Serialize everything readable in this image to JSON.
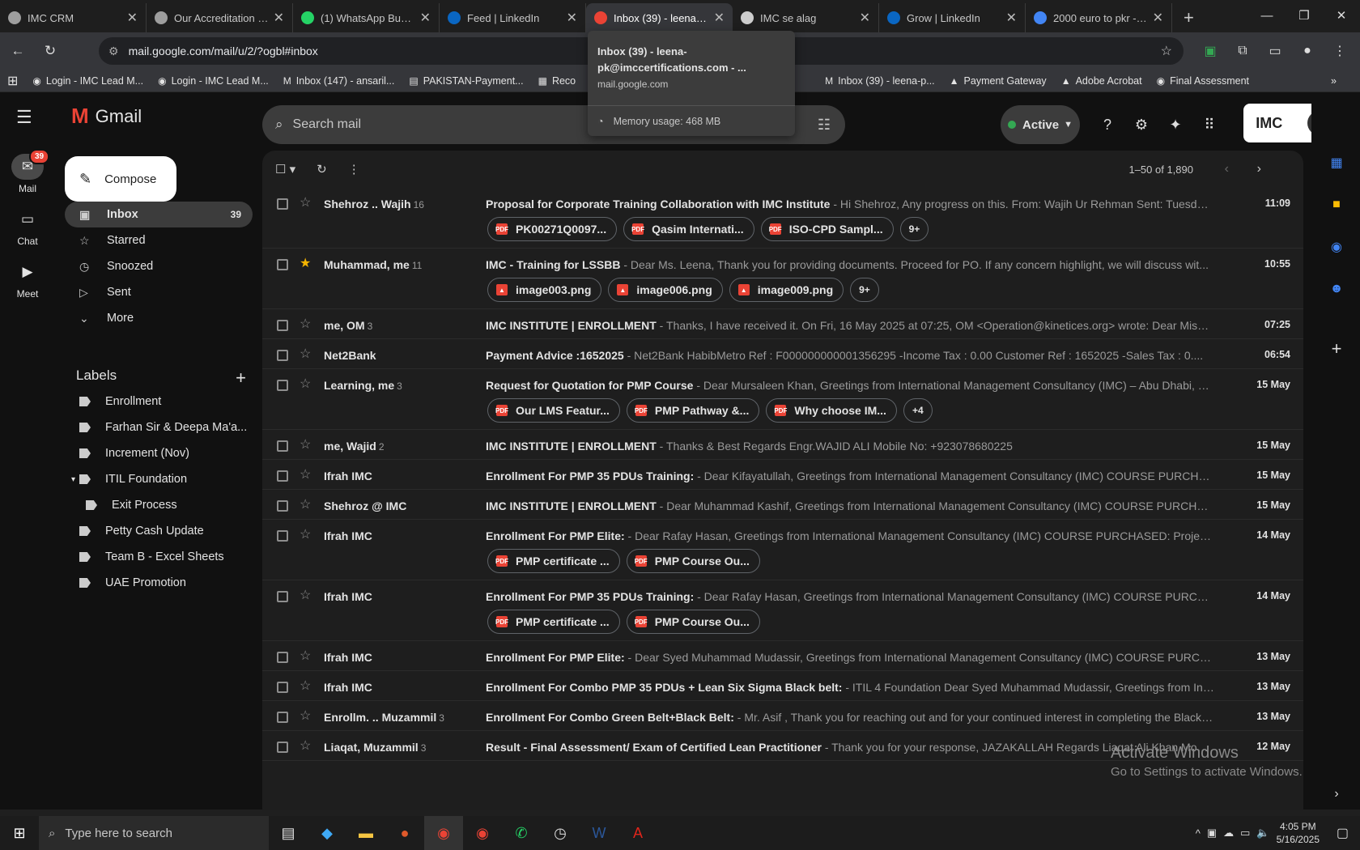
{
  "browser": {
    "tabs": [
      {
        "title": "IMC CRM",
        "color": "#9e9e9e"
      },
      {
        "title": "Our Accreditation | IMC",
        "color": "#9e9e9e"
      },
      {
        "title": "(1) WhatsApp Business",
        "color": "#25d366"
      },
      {
        "title": "Feed | LinkedIn",
        "color": "#0a66c2"
      },
      {
        "title": "Inbox (39) - leena-pk@",
        "color": "#ea4335"
      },
      {
        "title": "IMC se alag",
        "color": "#cccccc"
      },
      {
        "title": "Grow | LinkedIn",
        "color": "#0a66c2"
      },
      {
        "title": "2000 euro to pkr - Google",
        "color": "#4285f4"
      }
    ],
    "active_tab_index": 4,
    "url": "mail.google.com/mail/u/2/?ogbl#inbox",
    "bookmarks": [
      "Login - IMC Lead M...",
      "Login - IMC Lead M...",
      "Inbox (147) - ansaril...",
      "PAKISTAN-Payment...",
      "Reco",
      "Inbox (39) - leena-p...",
      "Payment Gateway",
      "Adobe Acrobat",
      "Final Assessment"
    ],
    "tooltip": {
      "title": "Inbox (39) - leena-pk@imccertifications.com - ...",
      "url": "mail.google.com",
      "memory": "Memory usage: 468 MB"
    }
  },
  "gmail": {
    "logo": "Gmail",
    "search_placeholder": "Search mail",
    "status": "Active",
    "rail": [
      {
        "label": "Mail",
        "badge": "39"
      },
      {
        "label": "Chat"
      },
      {
        "label": "Meet"
      }
    ],
    "compose": "Compose",
    "nav": [
      {
        "label": "Inbox",
        "count": "39"
      },
      {
        "label": "Starred"
      },
      {
        "label": "Snoozed"
      },
      {
        "label": "Sent"
      },
      {
        "label": "More"
      }
    ],
    "labels_title": "Labels",
    "labels": [
      "Enrollment",
      "Farhan Sir & Deepa Ma'a...",
      "Increment (Nov)",
      "ITIL Foundation",
      "Exit Process",
      "Petty Cash Update",
      "Team B - Excel Sheets",
      "UAE Promotion"
    ],
    "range": "1–50 of 1,890",
    "imc_brand": "IMC",
    "emails": [
      {
        "sender": "Shehroz .. Wajih",
        "count": "16",
        "subject": "Proposal for Corporate Training Collaboration with IMC Institute",
        "snippet": " - Hi Shehroz, Any progress on this. From: Wajih Ur Rehman Sent: Tuesday, M...",
        "date": "11:09",
        "starred": false,
        "attachments": [
          "PK00271Q0097...",
          "Qasim Internati...",
          "ISO-CPD Sampl..."
        ],
        "more": "9+"
      },
      {
        "sender": "Muhammad, me",
        "count": "11",
        "subject": "IMC - Training for LSSBB",
        "snippet": " - Dear Ms. Leena, Thank you for providing documents. Proceed for PO. If any concern highlight, we will discuss wit...",
        "date": "10:55",
        "starred": true,
        "attachments": [
          "image003.png",
          "image006.png",
          "image009.png"
        ],
        "more": "9+"
      },
      {
        "sender": "me, OM",
        "count": "3",
        "subject": "IMC INSTITUTE | ENROLLMENT",
        "snippet": " - Thanks, I have received it. On Fri, 16 May 2025 at 07:25, OM <Operation@kinetices.org> wrote: Dear Miss Le...",
        "date": "07:25",
        "starred": false,
        "attachments": [],
        "more": ""
      },
      {
        "sender": "Net2Bank",
        "count": "",
        "subject": "Payment Advice :1652025",
        "snippet": " - Net2Bank HabibMetro Ref : F000000000001356295 -Income Tax : 0.00 Customer Ref : 1652025 -Sales Tax : 0....",
        "date": "06:54",
        "starred": false,
        "attachments": [],
        "more": ""
      },
      {
        "sender": "Learning, me",
        "count": "3",
        "subject": "Request for Quotation for PMP Course",
        "snippet": " - Dear Mursaleen Khan, Greetings from International Management Consultancy (IMC) – Abu Dhabi, U...",
        "date": "15 May",
        "starred": false,
        "attachments": [
          "Our LMS Featur...",
          "PMP Pathway &...",
          "Why choose IM..."
        ],
        "more": "+4"
      },
      {
        "sender": "me, Wajid",
        "count": "2",
        "subject": "IMC INSTITUTE | ENROLLMENT",
        "snippet": " - Thanks & Best Regards Engr.WAJID ALI Mobile No: +923078680225",
        "date": "15 May",
        "starred": false,
        "attachments": [],
        "more": ""
      },
      {
        "sender": "Ifrah IMC",
        "count": "",
        "subject": "Enrollment For PMP 35 PDUs Training:",
        "snippet": " - Dear Kifayatullah, Greetings from International Management Consultancy (IMC) COURSE PURCHASE...",
        "date": "15 May",
        "starred": false,
        "attachments": [],
        "more": ""
      },
      {
        "sender": "Shehroz @ IMC",
        "count": "",
        "subject": "IMC INSTITUTE | ENROLLMENT",
        "snippet": " - Dear Muhammad Kashif, Greetings from International Management Consultancy (IMC) COURSE PURCHASE...",
        "date": "15 May",
        "starred": false,
        "attachments": [],
        "more": ""
      },
      {
        "sender": "Ifrah IMC",
        "count": "",
        "subject": "Enrollment For PMP Elite:",
        "snippet": " - Dear Rafay Hasan, Greetings from International Management Consultancy (IMC) COURSE PURCHASED: Project ...",
        "date": "14 May",
        "starred": false,
        "attachments": [
          "PMP certificate ...",
          "PMP Course Ou..."
        ],
        "more": ""
      },
      {
        "sender": "Ifrah IMC",
        "count": "",
        "subject": "Enrollment For PMP 35 PDUs Training:",
        "snippet": " - Dear Rafay Hasan, Greetings from International Management Consultancy (IMC) COURSE PURCHAS...",
        "date": "14 May",
        "starred": false,
        "attachments": [
          "PMP certificate ...",
          "PMP Course Ou..."
        ],
        "more": ""
      },
      {
        "sender": "Ifrah IMC",
        "count": "",
        "subject": "Enrollment For PMP Elite:",
        "snippet": " - Dear Syed Muhammad Mudassir, Greetings from International Management Consultancy (IMC) COURSE PURCHA...",
        "date": "13 May",
        "starred": false,
        "attachments": [],
        "more": ""
      },
      {
        "sender": "Ifrah IMC",
        "count": "",
        "subject": "Enrollment For Combo PMP 35 PDUs + Lean Six Sigma Black belt:",
        "snippet": " - ITIL 4 Foundation Dear Syed Muhammad Mudassir, Greetings from Intern...",
        "date": "13 May",
        "starred": false,
        "attachments": [],
        "more": ""
      },
      {
        "sender": "Enrollm. .. Muzammil",
        "count": "3",
        "subject": "Enrollment For Combo Green Belt+Black Belt:",
        "snippet": " - Mr. Asif , Thank you for reaching out and for your continued interest in completing the Blackb...",
        "date": "13 May",
        "starred": false,
        "attachments": [],
        "more": ""
      },
      {
        "sender": "Liaqat, Muzammil",
        "count": "3",
        "subject": "Result - Final Assessment/ Exam of Certified Lean Practitioner",
        "snippet": " - Thank you for your response, JAZAKALLAH Regards Liaqat Ali Khan Mobile ...",
        "date": "12 May",
        "starred": false,
        "attachments": [],
        "more": ""
      }
    ]
  },
  "watermark": {
    "line1": "Activate Windows",
    "line2": "Go to Settings to activate Windows."
  },
  "taskbar": {
    "search": "Type here to search",
    "time": "4:05 PM",
    "date": "5/16/2025"
  }
}
